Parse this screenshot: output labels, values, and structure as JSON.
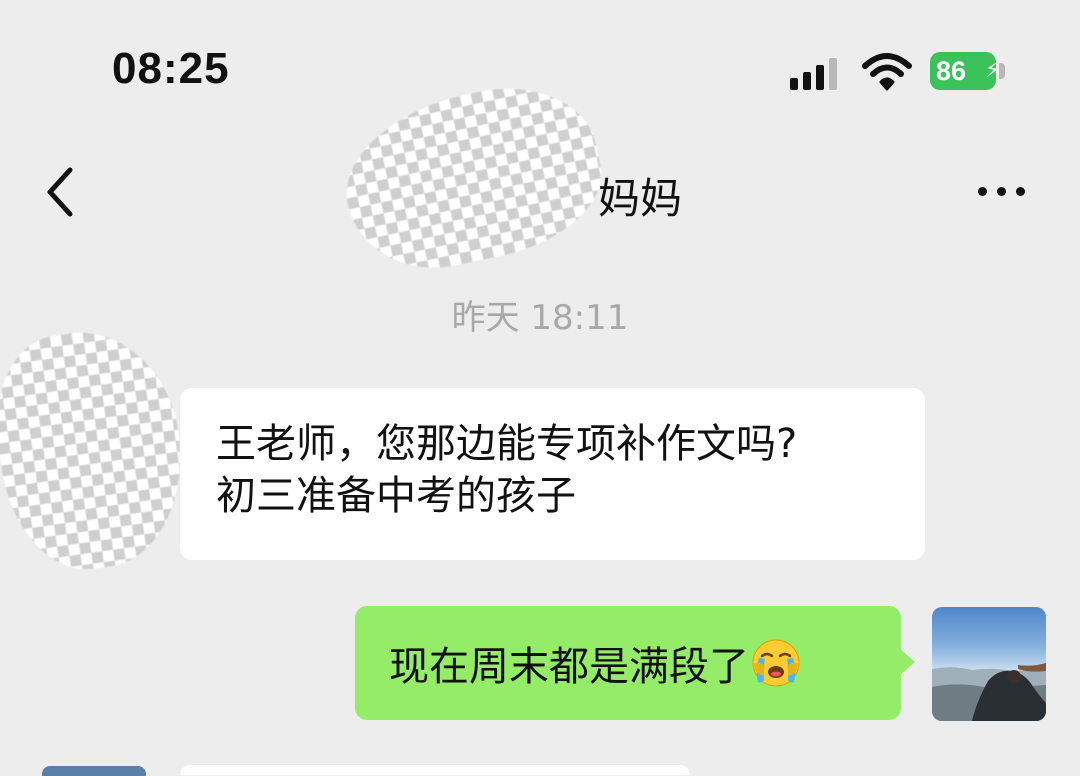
{
  "status_bar": {
    "time": "08:25",
    "battery": "86",
    "signal_bars_active": 3,
    "signal_bars_total": 4
  },
  "nav": {
    "title": "妈妈",
    "title_prefix_redacted": true
  },
  "messages": [
    {
      "type": "timestamp",
      "text": "昨天 18:11"
    },
    {
      "type": "incoming",
      "lines": [
        "王老师，您那边能专项补作文吗?",
        "初三准备中考的孩子"
      ],
      "avatar_redacted": true
    },
    {
      "type": "outgoing",
      "text": "现在周末都是满段了",
      "emoji": "loudly-crying-face"
    }
  ],
  "colors": {
    "background": "#ededed",
    "incoming_bubble": "#ffffff",
    "outgoing_bubble": "#95ec69",
    "battery": "#3cc25a",
    "timestamp_text": "#a8a8a8"
  },
  "icons": [
    "back-chevron-icon",
    "more-icon",
    "signal-icon",
    "wifi-icon",
    "battery-icon",
    "charging-bolt-icon"
  ]
}
